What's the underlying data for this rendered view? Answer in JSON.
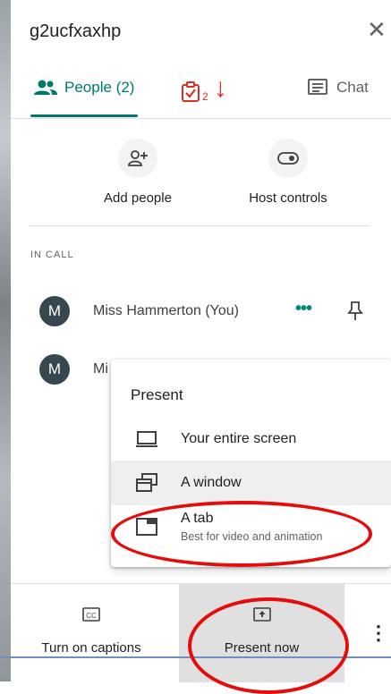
{
  "meeting": {
    "title": "g2ucfxaxhp"
  },
  "tabs": {
    "people_label": "People (2)",
    "tasks_count": "2",
    "chat_label": "Chat"
  },
  "actions": {
    "add_people": "Add people",
    "host_controls": "Host controls"
  },
  "section_title": "IN CALL",
  "participants": [
    {
      "initial": "M",
      "name": "Miss Hammerton (You)"
    },
    {
      "initial": "M",
      "name": "Mi"
    }
  ],
  "present_menu": {
    "title": "Present",
    "options": [
      {
        "label": "Your entire screen"
      },
      {
        "label": "A window"
      },
      {
        "label": "A tab",
        "sublabel": "Best for video and animation"
      }
    ]
  },
  "bottom_bar": {
    "captions_label": "Turn on captions",
    "present_label": "Present now"
  },
  "colors": {
    "accent": "#00796b",
    "annotation_red": "#e50c0c",
    "tasks_red": "#d93025"
  }
}
